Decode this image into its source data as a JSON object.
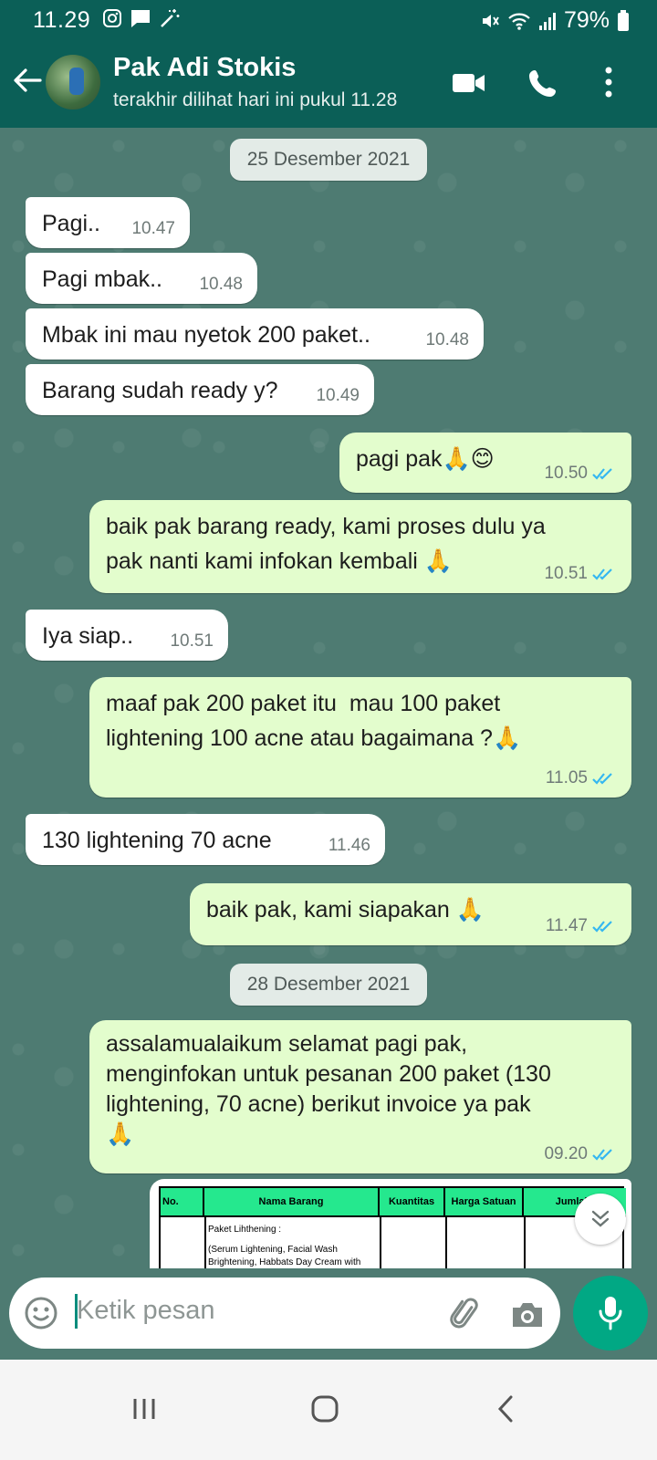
{
  "status_bar": {
    "time": "11.29",
    "battery": "79%"
  },
  "header": {
    "contact_name": "Pak Adi Stokis",
    "last_seen": "terakhir dilihat hari ini pukul 11.28"
  },
  "dates": [
    "25 Desember 2021",
    "28 Desember 2021"
  ],
  "messages": [
    {
      "dir": "in",
      "text": "Pagi..",
      "time": "10.47"
    },
    {
      "dir": "in",
      "text": "Pagi mbak..",
      "time": "10.48"
    },
    {
      "dir": "in",
      "text": "Mbak ini mau nyetok 200 paket..",
      "time": "10.48"
    },
    {
      "dir": "in",
      "text": "Barang sudah ready y?",
      "time": "10.49"
    },
    {
      "dir": "out",
      "text": "pagi pak🙏😊",
      "time": "10.50",
      "status": "read"
    },
    {
      "dir": "out",
      "text": "baik pak barang ready, kami proses dulu ya\npak nanti kami infokan kembali 🙏",
      "time": "10.51",
      "status": "read"
    },
    {
      "dir": "in",
      "text": "Iya siap..",
      "time": "10.51"
    },
    {
      "dir": "out",
      "text": "maaf pak 200 paket itu  mau 100 paket\nlightening 100 acne atau bagaimana ?🙏",
      "time": "11.05",
      "status": "read"
    },
    {
      "dir": "in",
      "text": "130 lightening 70 acne",
      "time": "11.46"
    },
    {
      "dir": "out",
      "text": "baik pak, kami siapakan 🙏",
      "time": "11.47",
      "status": "read"
    },
    {
      "dir": "out",
      "text": "assalamualaikum selamat pagi pak,\nmenginfokan untuk pesanan 200 paket (130\nlightening, 70 acne) berikut invoice ya pak\n🙏",
      "time": "09.20",
      "status": "read"
    }
  ],
  "invoice": {
    "headers": [
      "No.",
      "Nama Barang",
      "Kuantitas",
      "Harga Satuan",
      "Jumlah"
    ],
    "rows": [
      "Paket Lihthening :",
      "(Serum Lightening, Facial Wash",
      "Brightening, Habbats Day Cream with"
    ]
  },
  "input": {
    "placeholder": "Ketik pesan"
  },
  "colors": {
    "header": "#0b5f57",
    "outgoing": "#e3fdcd",
    "incoming": "#ffffff",
    "accent": "#01a884",
    "tick": "#34b7f1"
  }
}
